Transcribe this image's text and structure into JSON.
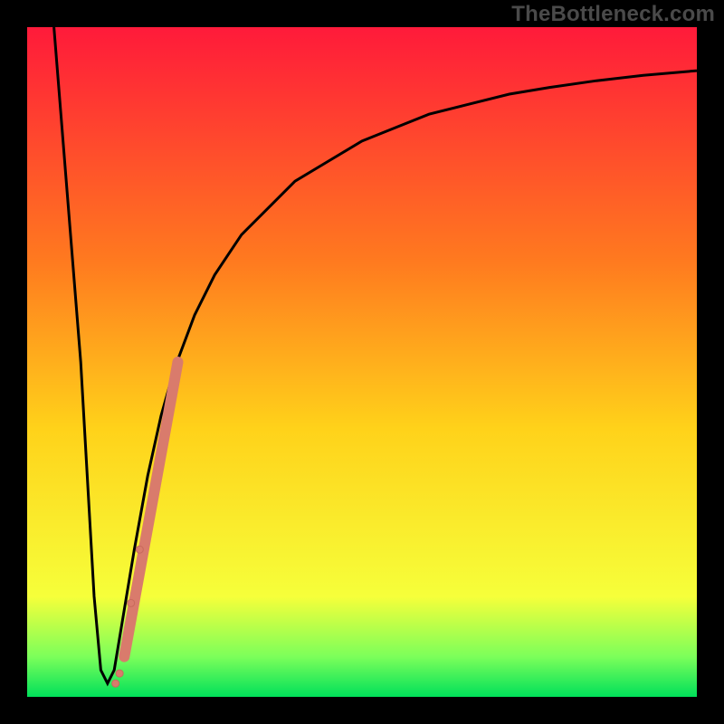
{
  "watermark": "TheBottleneck.com",
  "colors": {
    "curve_stroke": "#000000",
    "marker_fill": "#d97b6c",
    "marker_stroke": "#c86a5c",
    "gradient_top": "#ff1a3a",
    "gradient_upper_mid": "#ff7a1f",
    "gradient_mid": "#ffd21a",
    "gradient_lower_mid": "#f6ff3a",
    "gradient_green_band": "#7cff5a",
    "gradient_bottom": "#00e05a",
    "frame": "#000000"
  },
  "chart_data": {
    "type": "line",
    "title": "",
    "xlabel": "",
    "ylabel": "",
    "xlim": [
      0,
      100
    ],
    "ylim": [
      0,
      100
    ],
    "curve": {
      "x": [
        4,
        8,
        10,
        11,
        12,
        13,
        14,
        16,
        18,
        20,
        22,
        25,
        28,
        32,
        36,
        40,
        45,
        50,
        55,
        60,
        66,
        72,
        78,
        85,
        92,
        100
      ],
      "y": [
        100,
        50,
        15,
        4,
        2,
        4,
        10,
        22,
        33,
        42,
        49,
        57,
        63,
        69,
        73,
        77,
        80,
        83,
        85,
        87,
        88.5,
        90,
        91,
        92,
        92.8,
        93.5
      ]
    },
    "markers_segment": {
      "x_start": 14.5,
      "y_start": 6,
      "x_end": 22.5,
      "y_end": 50,
      "radius": 6
    },
    "markers_points": [
      {
        "x": 13.2,
        "y": 2.0,
        "r": 4
      },
      {
        "x": 13.8,
        "y": 3.5,
        "r": 4
      },
      {
        "x": 15.5,
        "y": 14.0,
        "r": 4
      },
      {
        "x": 16.8,
        "y": 22.0,
        "r": 4
      }
    ]
  }
}
